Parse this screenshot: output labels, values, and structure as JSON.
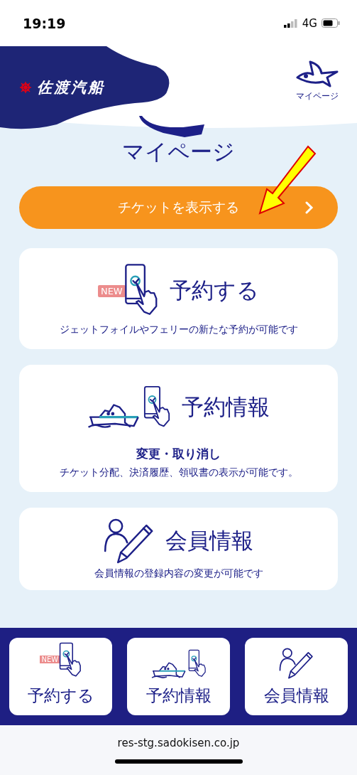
{
  "status_bar": {
    "time": "19:19",
    "network": "4G"
  },
  "header": {
    "logo_text": "佐渡汽船",
    "mypage_link": "マイページ"
  },
  "page_title": "マイページ",
  "ticket_button": {
    "label": "チケットを表示する"
  },
  "cards": [
    {
      "kind": "reserve",
      "badge": "NEW",
      "title": "予約する",
      "description": "ジェットフォイルやフェリーの新たな予約が可能です"
    },
    {
      "kind": "booking",
      "title": "予約情報",
      "subtitle": "変更・取り消し",
      "description": "チケット分配、決済履歴、領収書の表示が可能です。"
    },
    {
      "kind": "member",
      "title": "会員情報",
      "description": "会員情報の登録内容の変更が可能です"
    }
  ],
  "bottom_nav": [
    {
      "kind": "reserve",
      "badge": "NEW",
      "label": "予約する"
    },
    {
      "kind": "booking",
      "label": "予約情報"
    },
    {
      "kind": "member",
      "label": "会員情報"
    }
  ],
  "browser": {
    "url": "res-stg.sadokisen.co.jp"
  }
}
